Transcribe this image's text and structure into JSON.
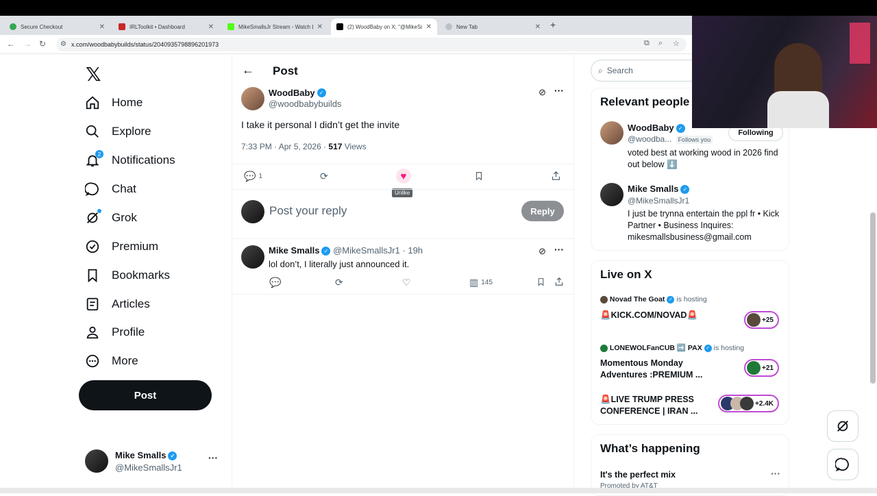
{
  "browser": {
    "tabs": [
      {
        "title": "Secure Checkout",
        "color": "#34a853"
      },
      {
        "title": "IRLToolkit • Dashboard",
        "color": "#c62828"
      },
      {
        "title": "MikeSmallsJr Stream - Watch Li",
        "color": "#53fc18"
      },
      {
        "title": "(2) WoodBaby on X: \"@MikeSm",
        "color": "#000000"
      },
      {
        "title": "New Tab",
        "color": "#5f6368"
      }
    ],
    "url": "x.com/woodbabybuilds/status/2040935798896201973"
  },
  "nav": {
    "items": [
      {
        "label": "Home",
        "icon": "home-icon"
      },
      {
        "label": "Explore",
        "icon": "search-icon"
      },
      {
        "label": "Notifications",
        "icon": "bell-icon",
        "badge": "2"
      },
      {
        "label": "Chat",
        "icon": "chat-icon"
      },
      {
        "label": "Grok",
        "icon": "grok-icon"
      },
      {
        "label": "Premium",
        "icon": "premium-icon"
      },
      {
        "label": "Bookmarks",
        "icon": "bookmark-icon"
      },
      {
        "label": "Articles",
        "icon": "article-icon"
      },
      {
        "label": "Profile",
        "icon": "person-icon"
      },
      {
        "label": "More",
        "icon": "more-icon"
      }
    ],
    "post_label": "Post",
    "account": {
      "name": "Mike Smalls",
      "handle": "@MikeSmallsJr1"
    }
  },
  "header": {
    "title": "Post"
  },
  "post": {
    "author": "WoodBaby",
    "handle": "@woodbabybuilds",
    "text": "I take it personal I didn’t get the invite",
    "meta_time": "7:33 PM · Apr 5, 2026 · ",
    "views_count": "517",
    "views_label": " Views",
    "reply_count": "1",
    "tooltip": "Unlike"
  },
  "composer": {
    "placeholder": "Post your reply",
    "button": "Reply"
  },
  "reply": {
    "author": "Mike Smalls",
    "handle": "@MikeSmallsJr1",
    "time": "· 19h",
    "text": "lol don’t, I literally just announced it.",
    "views": "145"
  },
  "search": {
    "placeholder": "Search"
  },
  "relevant": {
    "title": "Relevant people",
    "people": [
      {
        "name": "WoodBaby",
        "handle": "@woodba...",
        "follows_you": "Follows you",
        "button": "Following",
        "bio": "voted best at working wood in 2026 find out below ⬇️"
      },
      {
        "name": "Mike Smalls",
        "handle": "@MikeSmallsJr1",
        "bio": "I just be trynna entertain the ppl fr • Kick Partner • Business Inquires: mikesmallsbusiness@gmail.com"
      }
    ]
  },
  "live": {
    "title": "Live on X",
    "items": [
      {
        "host": "Novad The Goat",
        "hosting": "is hosting",
        "title": "🚨KICK.COM/NOVAD🚨",
        "count": "+25"
      },
      {
        "host": "LONEWOLFanCUB ➡️ PAX",
        "hosting": "is hosting",
        "title": "Momentous Monday Adventures :PREMIUM ...",
        "count": "+21"
      },
      {
        "host": "",
        "hosting": "",
        "title": "🚨LIVE TRUMP PRESS CONFERENCE | IRAN ...",
        "count": "+2.4K"
      }
    ]
  },
  "happening": {
    "title": "What’s happening",
    "first": "It's the perfect mix",
    "promoted": "Promoted by AT&T"
  }
}
